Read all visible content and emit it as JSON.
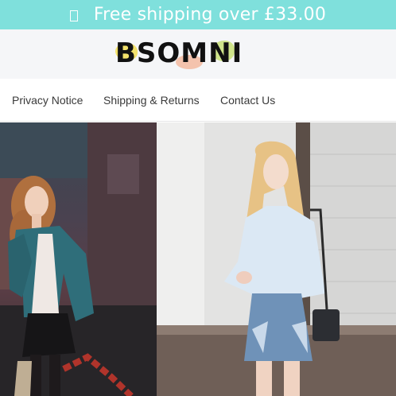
{
  "promo": {
    "text": "Free shipping over £33.00",
    "icon": "shipping-box-icon"
  },
  "header": {
    "logo_text": "BSOMNI"
  },
  "nav": {
    "items": [
      {
        "label": "Privacy Notice"
      },
      {
        "label": "Shipping & Returns"
      },
      {
        "label": "Contact Us"
      }
    ]
  },
  "hero": {
    "left_image": "woman-red-hair-teal-cardigan-black-skirt-street",
    "right_image": "woman-blonde-white-shirt-denim-skirt-wall"
  },
  "colors": {
    "promo_bg": "#7fe0dc",
    "header_bg": "#f5f6f8",
    "logo_text": "#111111",
    "nav_text": "#3a3a3a"
  }
}
